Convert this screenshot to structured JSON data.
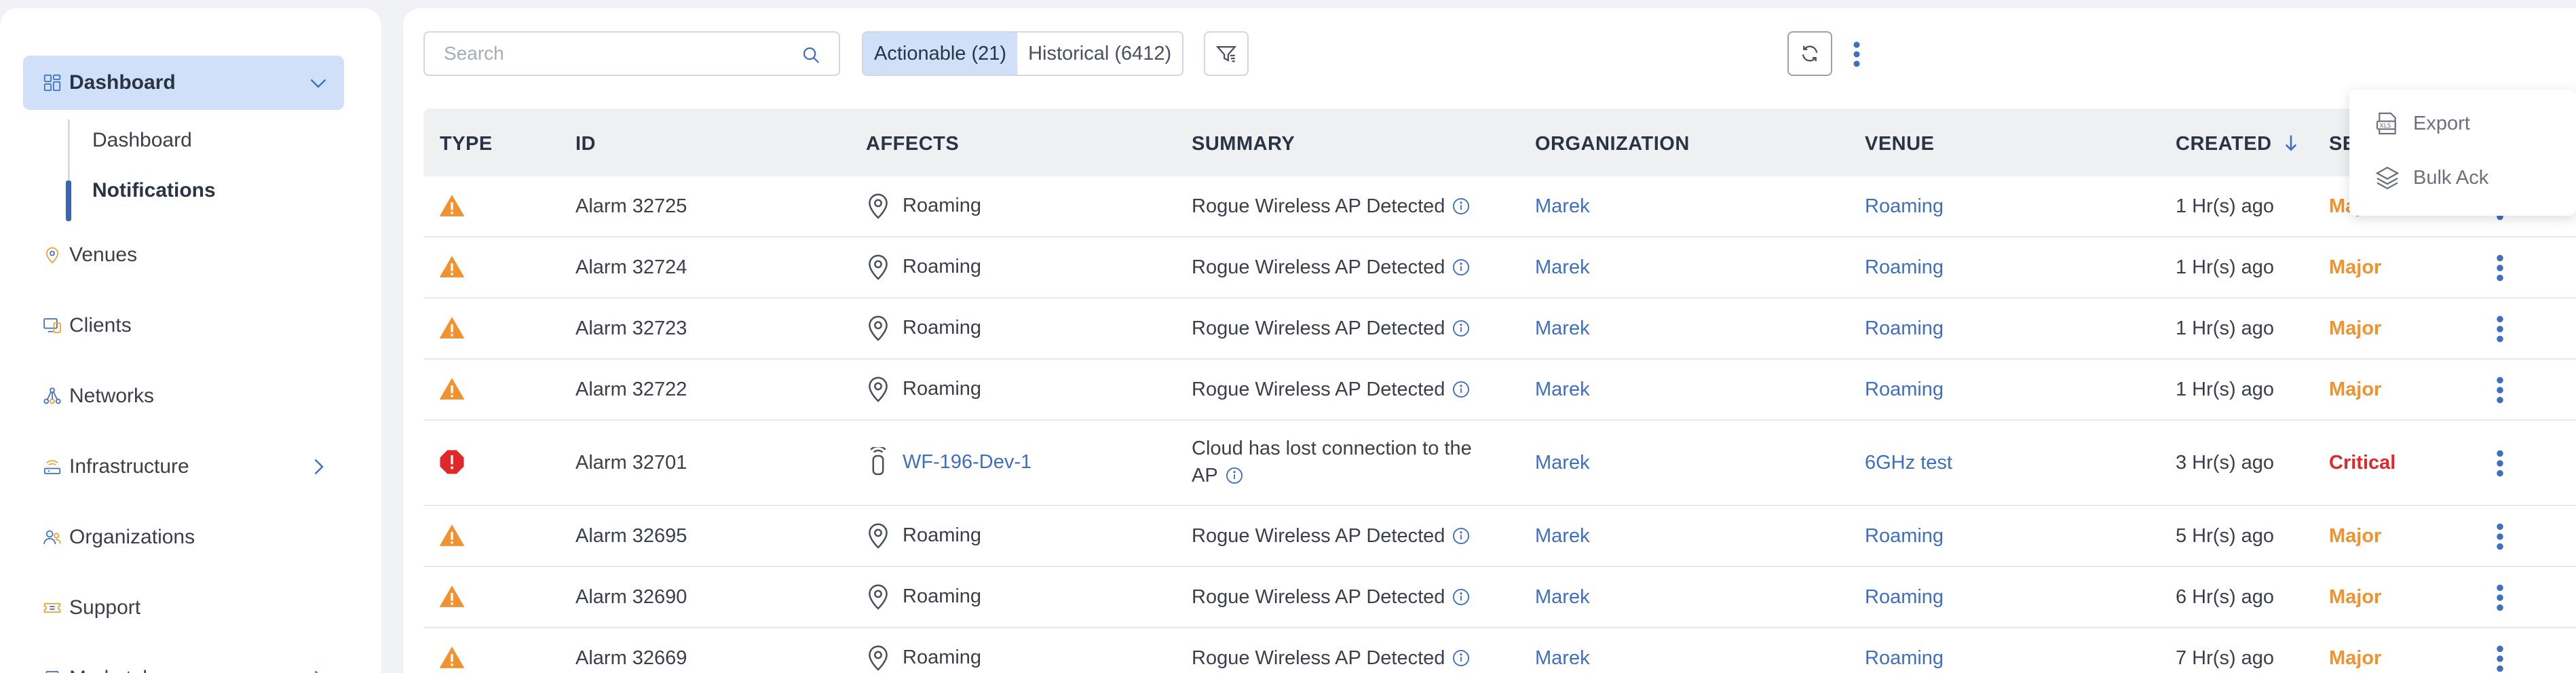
{
  "colors": {
    "accent": "#3f6fc0",
    "active_bg": "#cfe0f8",
    "major": "#f0922f",
    "critical": "#e0282a"
  },
  "sidebar": {
    "items": [
      {
        "label": "Dashboard",
        "icon": "dashboard-grid-icon",
        "active": true,
        "expanded": true
      },
      {
        "label": "Venues",
        "icon": "map-pin-icon"
      },
      {
        "label": "Clients",
        "icon": "devices-icon"
      },
      {
        "label": "Networks",
        "icon": "network-topology-icon"
      },
      {
        "label": "Infrastructure",
        "icon": "access-point-icon"
      },
      {
        "label": "Organizations",
        "icon": "users-icon"
      },
      {
        "label": "Support",
        "icon": "ticket-icon"
      },
      {
        "label": "Marketplace",
        "icon": "store-icon"
      }
    ],
    "sub_items": [
      {
        "label": "Dashboard"
      },
      {
        "label": "Notifications",
        "active": true
      }
    ]
  },
  "toolbar": {
    "search_placeholder": "Search",
    "tab_actionable": "Actionable (21)",
    "tab_historical": "Historical (6412)"
  },
  "table": {
    "headers": [
      "TYPE",
      "ID",
      "AFFECTS",
      "SUMMARY",
      "ORGANIZATION",
      "VENUE",
      "CREATED",
      "SEVERITY"
    ],
    "sorted_column": "CREATED",
    "sort_direction": "descending",
    "rows": [
      {
        "type": "warning",
        "id": "Alarm 32725",
        "affects": "Roaming",
        "affects_kind": "location",
        "summary": "Rogue Wireless AP Detected",
        "organization": "Marek",
        "venue": "Roaming",
        "created": "1 Hr(s) ago",
        "severity": "Major"
      },
      {
        "type": "warning",
        "id": "Alarm 32724",
        "affects": "Roaming",
        "affects_kind": "location",
        "summary": "Rogue Wireless AP Detected",
        "organization": "Marek",
        "venue": "Roaming",
        "created": "1 Hr(s) ago",
        "severity": "Major"
      },
      {
        "type": "warning",
        "id": "Alarm 32723",
        "affects": "Roaming",
        "affects_kind": "location",
        "summary": "Rogue Wireless AP Detected",
        "organization": "Marek",
        "venue": "Roaming",
        "created": "1 Hr(s) ago",
        "severity": "Major"
      },
      {
        "type": "warning",
        "id": "Alarm 32722",
        "affects": "Roaming",
        "affects_kind": "location",
        "summary": "Rogue Wireless AP Detected",
        "organization": "Marek",
        "venue": "Roaming",
        "created": "1 Hr(s) ago",
        "severity": "Major"
      },
      {
        "type": "critical",
        "id": "Alarm 32701",
        "affects": "WF-196-Dev-1",
        "affects_kind": "device",
        "summary_line1": "Cloud has lost connection to the",
        "summary_line2": "AP",
        "organization": "Marek",
        "venue": "6GHz test",
        "created": "3 Hr(s) ago",
        "severity": "Critical"
      },
      {
        "type": "warning",
        "id": "Alarm 32695",
        "affects": "Roaming",
        "affects_kind": "location",
        "summary": "Rogue Wireless AP Detected",
        "organization": "Marek",
        "venue": "Roaming",
        "created": "5 Hr(s) ago",
        "severity": "Major"
      },
      {
        "type": "warning",
        "id": "Alarm 32690",
        "affects": "Roaming",
        "affects_kind": "location",
        "summary": "Rogue Wireless AP Detected",
        "organization": "Marek",
        "venue": "Roaming",
        "created": "6 Hr(s) ago",
        "severity": "Major"
      },
      {
        "type": "warning",
        "id": "Alarm 32669",
        "affects": "Roaming",
        "affects_kind": "location",
        "summary": "Rogue Wireless AP Detected",
        "organization": "Marek",
        "venue": "Roaming",
        "created": "7 Hr(s) ago",
        "severity": "Major"
      }
    ]
  },
  "menu": {
    "export": "Export",
    "bulk_ack": "Bulk Ack"
  }
}
